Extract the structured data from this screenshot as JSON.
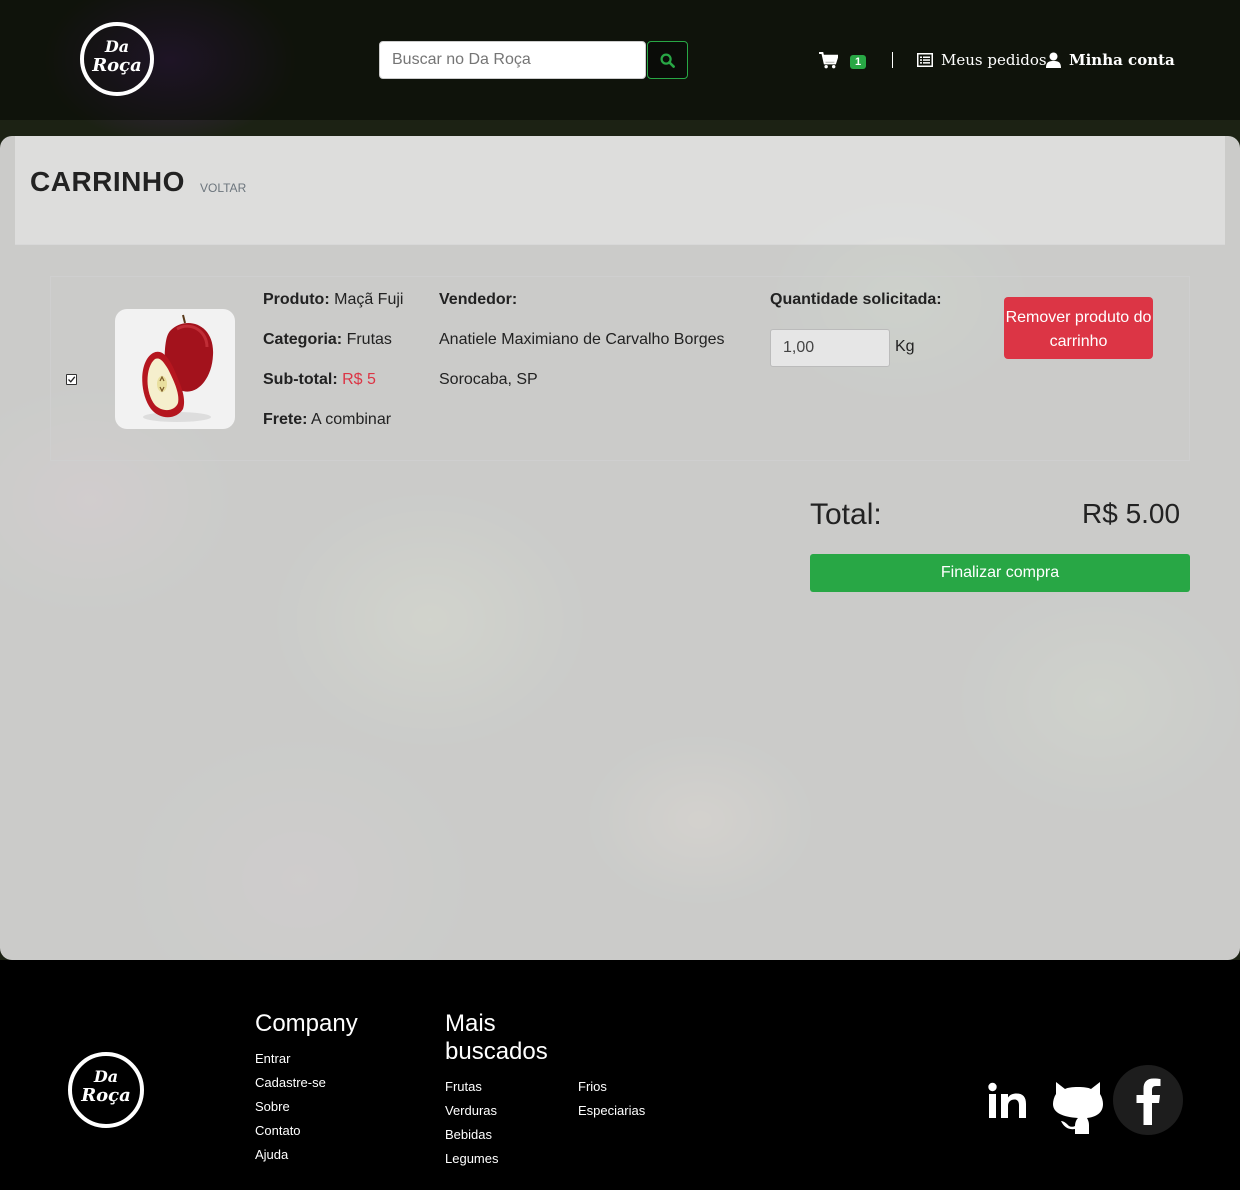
{
  "header": {
    "logo_line1": "Da",
    "logo_line2": "Roça",
    "search_placeholder": "Buscar no Da Roça",
    "cart_count": "1",
    "orders_label": "Meus pedidos",
    "account_label": "Minha conta"
  },
  "page": {
    "title": "CARRINHO",
    "back_label": "VOLTAR"
  },
  "cart_item": {
    "checked": true,
    "product_label": "Produto:",
    "product_value": "Maçã Fuji",
    "category_label": "Categoria:",
    "category_value": "Frutas",
    "subtotal_label": "Sub-total:",
    "subtotal_value": "R$ 5",
    "shipping_label": "Frete:",
    "shipping_value": "A combinar",
    "seller_label": "Vendedor:",
    "seller_name": "Anatiele Maximiano de Carvalho Borges",
    "seller_location": "Sorocaba, SP",
    "quantity_label": "Quantidade solicitada:",
    "quantity_value": "1,00",
    "quantity_unit": "Kg",
    "remove_label": "Remover produto do carrinho"
  },
  "summary": {
    "total_label": "Total:",
    "total_value": "R$ 5.00",
    "checkout_label": "Finalizar compra"
  },
  "footer": {
    "company_heading": "Company",
    "company_links": [
      "Entrar",
      "Cadastre-se",
      "Sobre",
      "Contato",
      "Ajuda"
    ],
    "popular_heading_line1": "Mais",
    "popular_heading_line2": "buscados",
    "popular_col1": [
      "Frutas",
      "Verduras",
      "Bebidas",
      "Legumes"
    ],
    "popular_col2": [
      "Frios",
      "Especiarias"
    ],
    "social": [
      "linkedin-icon",
      "github-icon",
      "facebook-icon"
    ]
  },
  "colors": {
    "accent_green": "#28a745",
    "danger_red": "#dc3545"
  }
}
